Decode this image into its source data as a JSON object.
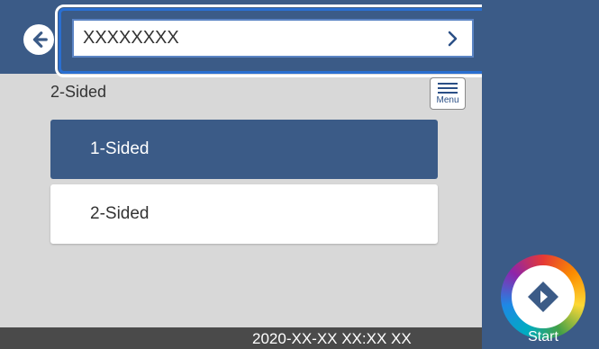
{
  "header": {
    "back_icon": "back-arrow-icon",
    "title_value": "XXXXXXXX",
    "chevron_icon": "chevron-right-icon"
  },
  "content": {
    "section_label": "2-Sided",
    "menu_label": "Menu",
    "options": [
      {
        "label": "1-Sided",
        "selected": true
      },
      {
        "label": "2-Sided",
        "selected": false
      }
    ]
  },
  "footer": {
    "datetime": "2020-XX-XX XX:XX XX"
  },
  "start": {
    "label": "Start",
    "icon": "start-diamond-icon"
  },
  "colors": {
    "accent": "#3b5b87",
    "background": "#d8d8d8",
    "highlight": "#2a6fd1"
  }
}
